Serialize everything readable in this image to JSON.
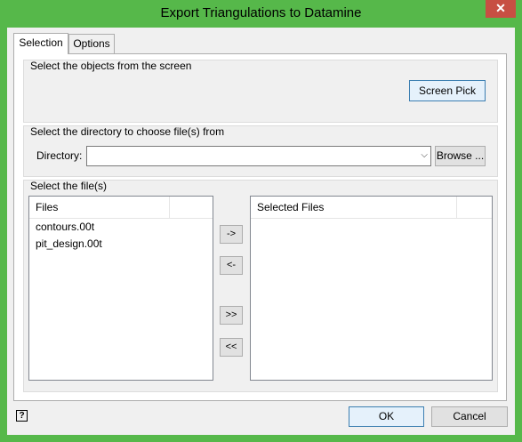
{
  "window": {
    "title": "Export Triangulations to Datamine",
    "close_glyph": "✕"
  },
  "tabs": [
    {
      "label": "Selection",
      "active": true
    },
    {
      "label": "Options",
      "active": false
    }
  ],
  "screen_group": {
    "label": "Select the objects from the screen",
    "screen_pick_label": "Screen Pick"
  },
  "directory_group": {
    "label": "Select the directory to choose file(s) from",
    "directory_label": "Directory:",
    "directory_value": "",
    "browse_label": "Browse ..."
  },
  "files_group": {
    "label": "Select the file(s)",
    "files_header": "Files",
    "files": [
      "contours.00t",
      "pit_design.00t"
    ],
    "selected_header": "Selected Files",
    "selected_files": []
  },
  "transfer_buttons": {
    "add_one": "->",
    "remove_one": "<-",
    "add_all": ">>",
    "remove_all": "<<"
  },
  "footer": {
    "help_glyph": "?",
    "ok_label": "OK",
    "cancel_label": "Cancel"
  },
  "colors": {
    "window_frame": "#56b84a",
    "close_button": "#c74f43",
    "dialog_background": "#f0f0f0",
    "primary_button_border": "#3c7fb1"
  }
}
